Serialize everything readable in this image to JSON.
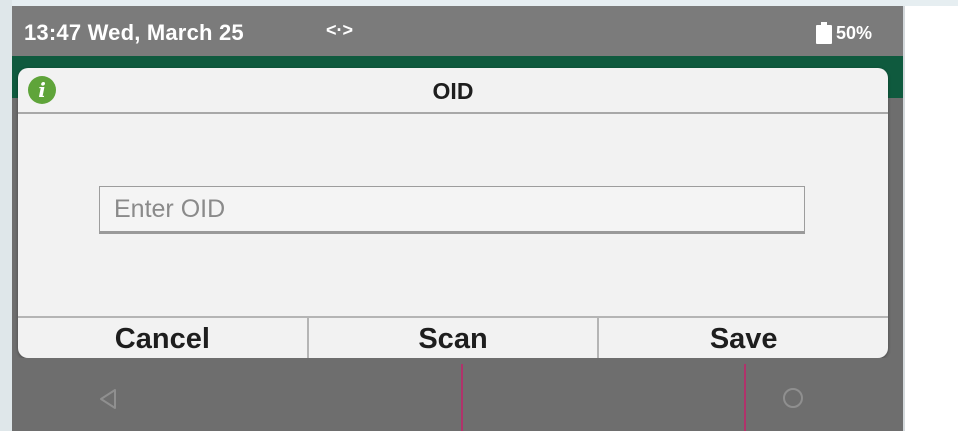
{
  "status_bar": {
    "time": "13:47 Wed, March 25",
    "sync_indicator": "<·>",
    "battery_icon": "battery-icon",
    "battery_level": "50%"
  },
  "dialog": {
    "title": "OID",
    "info_icon": "i",
    "input": {
      "placeholder": "Enter OID",
      "value": ""
    },
    "buttons": {
      "cancel": "Cancel",
      "scan": "Scan",
      "save": "Save"
    }
  },
  "nav_bar": {
    "back_icon": "back-icon",
    "home_icon": "home-icon"
  },
  "colors": {
    "app_bar": "#0f5a3e",
    "info_icon": "#5fa43a",
    "status_bar": "#7b7b7b",
    "annotation_line": "#b0336b"
  }
}
